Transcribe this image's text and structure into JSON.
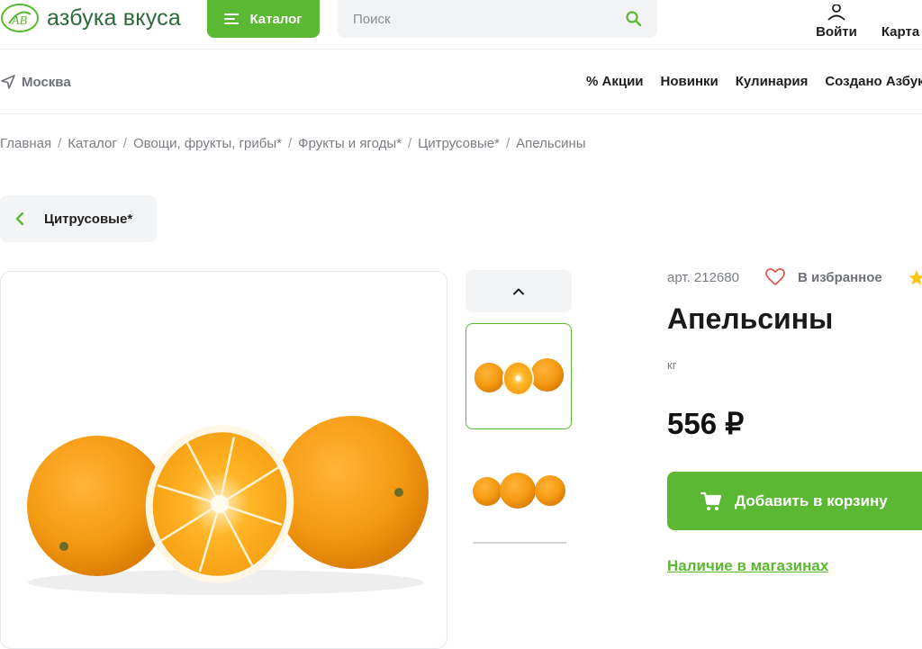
{
  "header": {
    "logo_text": "азбука вкуса",
    "logo_mark_text": "AB",
    "catalog_label": "Каталог",
    "search_placeholder": "Поиск",
    "login_label": "Войти",
    "cart_label": "Карта"
  },
  "subnav": {
    "city": "Москва",
    "links": [
      "% Акции",
      "Новинки",
      "Кулинария",
      "Создано Азбукой"
    ]
  },
  "breadcrumb": [
    "Главная",
    "Каталог",
    "Овощи, фрукты, грибы*",
    "Фрукты и ягоды*",
    "Цитрусовые*",
    "Апельсины"
  ],
  "back_label": "Цитрусовые*",
  "product": {
    "sku": "арт. 212680",
    "favorite_label": "В избранное",
    "title": "Апельсины",
    "unit": "кг",
    "price": "556 ₽",
    "add_to_cart_label": "Добавить в корзину",
    "stores_link": "Наличие в магазинах"
  },
  "colors": {
    "accent_green": "#5bb832",
    "brand_dark_green": "#2b6a3a",
    "favorite_heart": "#d9534f",
    "star": "#f5c518"
  }
}
